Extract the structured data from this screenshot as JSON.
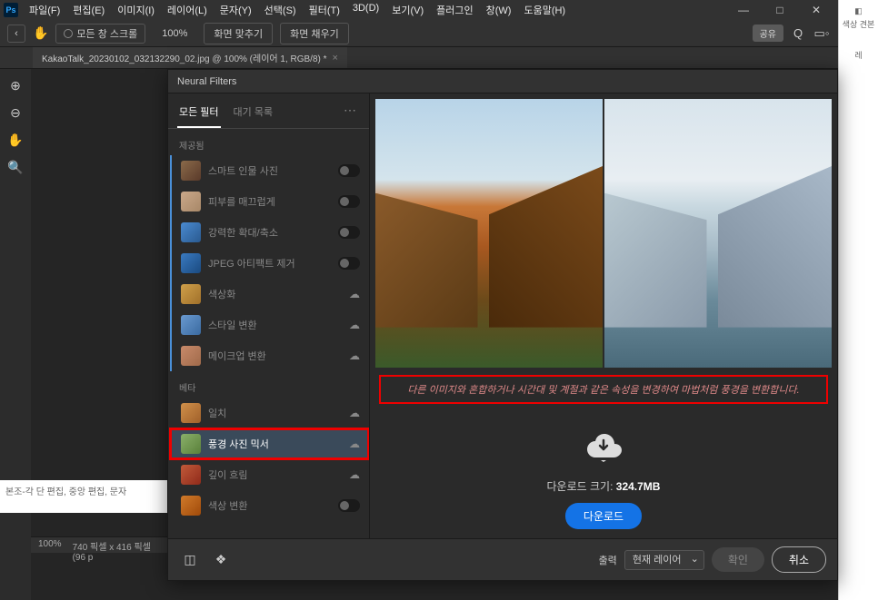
{
  "window": {
    "menus": [
      "파일(F)",
      "편집(E)",
      "이미지(I)",
      "레이어(L)",
      "문자(Y)",
      "선택(S)",
      "필터(T)",
      "3D(D)",
      "보기(V)",
      "플러그인",
      "창(W)",
      "도움말(H)"
    ]
  },
  "options_bar": {
    "scroll_all": "모든 창 스크롤",
    "zoom": "100%",
    "fit_screen": "화면 맞추기",
    "fill_screen": "화면 채우기",
    "share": "공유"
  },
  "doc_tab": {
    "title": "KakaoTalk_20230102_032132290_02.jpg @ 100% (레이어 1, RGB/8) *"
  },
  "status": {
    "zoom": "100%",
    "dims": "740 픽셀 x 416 픽셀 (96 p"
  },
  "bottom_text": "본조-각 단 편집, 중앙 편집, 문자",
  "neural_filters": {
    "title": "Neural Filters",
    "tab_all": "모든 필터",
    "tab_wait": "대기 목록",
    "section_featured": "제공됨",
    "section_beta": "베타",
    "filters_featured": [
      {
        "name": "스마트 인물 사진",
        "action": "toggle"
      },
      {
        "name": "피부를 매끄럽게",
        "action": "toggle"
      },
      {
        "name": "강력한 확대/축소",
        "action": "toggle"
      },
      {
        "name": "JPEG 아티팩트 제거",
        "action": "toggle"
      },
      {
        "name": "색상화",
        "action": "cloud"
      },
      {
        "name": "스타일 변환",
        "action": "cloud"
      },
      {
        "name": "메이크업 변환",
        "action": "cloud"
      }
    ],
    "filters_beta": [
      {
        "name": "일치",
        "action": "cloud"
      },
      {
        "name": "풍경 사진 믹서",
        "action": "cloud",
        "selected": true,
        "highlight": true
      },
      {
        "name": "깊이 흐림",
        "action": "cloud"
      },
      {
        "name": "색상 변환",
        "action": "toggle"
      }
    ],
    "description": "다른 이미지와 혼합하거나 시간대 및 계절과 같은 속성을 변경하여 마법처럼 풍경을 변환합니다.",
    "download_label": "다운로드 크기:",
    "download_size": "324.7MB",
    "download_btn": "다운로드",
    "output_label": "출력",
    "output_value": "현재 레이어",
    "ok": "확인",
    "cancel": "취소"
  },
  "right_panel": {
    "item1": "색상 견본",
    "item2": "레"
  }
}
